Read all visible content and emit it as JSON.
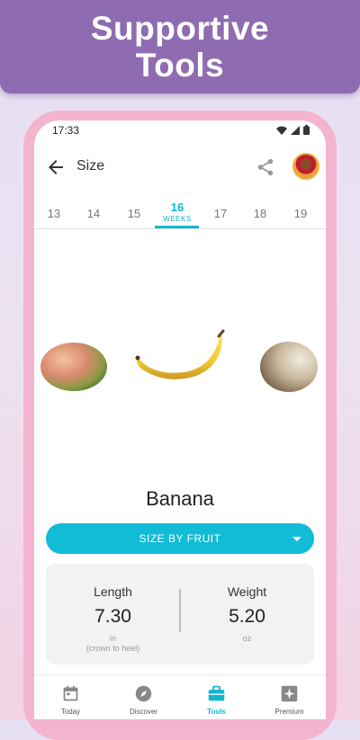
{
  "banner": {
    "title": "Supportive\nTools"
  },
  "status_bar": {
    "time": "17:33",
    "icons": [
      "wifi-icon",
      "cellular-icon",
      "battery-icon"
    ]
  },
  "app_bar": {
    "title": "Size",
    "back_icon": "arrow-left-icon",
    "share_icon": "share-icon",
    "avatar": "user-avatar"
  },
  "weeks": {
    "items": [
      "13",
      "14",
      "15",
      "16",
      "17",
      "18",
      "19"
    ],
    "selected": "16",
    "selected_caption": "WEEKS"
  },
  "fruits": [
    "mango",
    "banana",
    "coconut"
  ],
  "fruit_name": "Banana",
  "size_selector": {
    "label": "SIZE BY FRUIT"
  },
  "stats": {
    "length": {
      "label": "Length",
      "value": "7.30",
      "unit": "in",
      "note": "(crown to heel)"
    },
    "weight": {
      "label": "Weight",
      "value": "5.20",
      "unit": "oz"
    }
  },
  "tabs": [
    {
      "label": "Today",
      "icon": "calendar-icon"
    },
    {
      "label": "Discover",
      "icon": "compass-icon"
    },
    {
      "label": "Tools",
      "icon": "toolbox-icon",
      "active": true
    },
    {
      "label": "Premium",
      "icon": "plus-square-icon"
    }
  ],
  "colors": {
    "accent": "#13b5cf",
    "banner": "#8f6cb1",
    "phone_frame": "#f3b4cf"
  }
}
